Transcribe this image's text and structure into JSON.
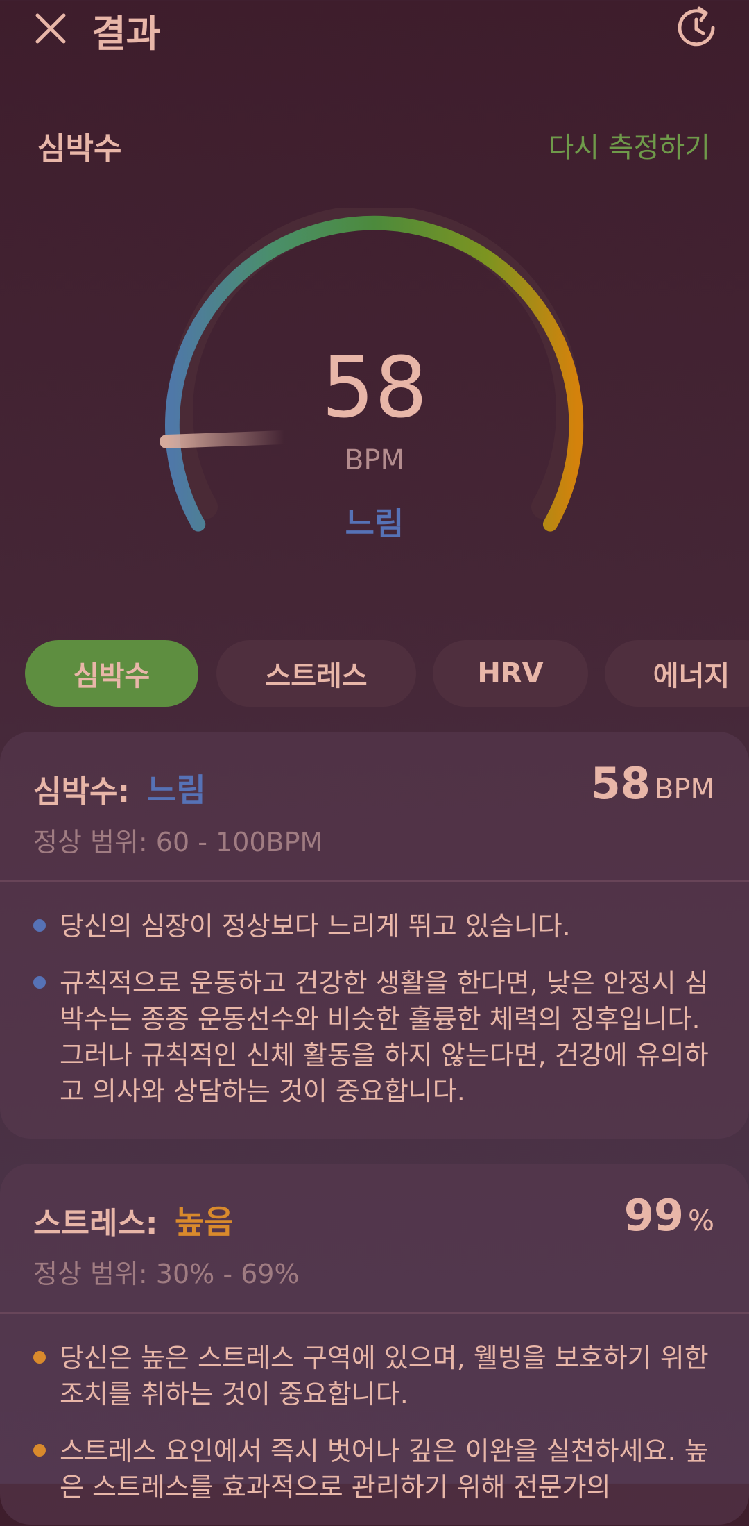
{
  "header": {
    "title": "결과",
    "close_icon": "close-icon",
    "history_icon": "history-icon"
  },
  "heart_rate": {
    "section_title": "심박수",
    "remeasure_label": "다시 측정하기",
    "value": "58",
    "unit": "BPM",
    "status": "느림"
  },
  "tabs": [
    {
      "label": "심박수",
      "active": true
    },
    {
      "label": "스트레스",
      "active": false
    },
    {
      "label": "HRV",
      "active": false
    },
    {
      "label": "에너지",
      "active": false
    }
  ],
  "cards": [
    {
      "label": "심박수:",
      "status": "느림",
      "status_color": "#5672b6",
      "value": "58",
      "unit": "BPM",
      "normal_range": "정상 범위: 60 - 100BPM",
      "bullet_color": "#5672b6",
      "bullets": [
        "당신의 심장이 정상보다 느리게 뛰고 있습니다.",
        "규칙적으로 운동하고 건강한 생활을 한다면, 낮은 안정시 심박수는 종종 운동선수와 비슷한 훌륭한 체력의 징후입니다. 그러나 규칙적인 신체 활동을 하지 않는다면, 건강에 유의하고 의사와 상담하는 것이 중요합니다."
      ]
    },
    {
      "label": "스트레스:",
      "status": "높음",
      "status_color": "#d98a2c",
      "value": "99",
      "unit": "%",
      "normal_range": "정상 범위: 30% - 69%",
      "bullet_color": "#d98a2c",
      "bullets": [
        "당신은 높은 스트레스 구역에 있으며, 웰빙을 보호하기 위한 조치를 취하는 것이 중요합니다.",
        "스트레스 요인에서 즉시 벗어나 깊은 이완을 실천하세요. 높은 스트레스를 효과적으로 관리하기 위해 전문가의"
      ]
    }
  ],
  "colors": {
    "accent_green": "#5e8e40",
    "slow_blue": "#5672b6",
    "high_orange": "#d98a2c"
  }
}
